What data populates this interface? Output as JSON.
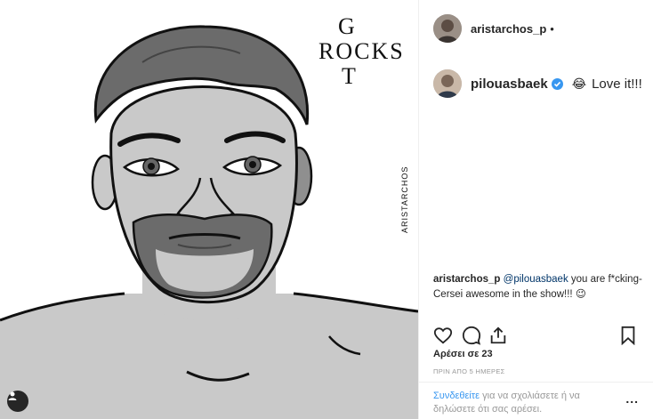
{
  "post": {
    "author": {
      "username": "aristarchos_p",
      "dot": "•"
    },
    "image": {
      "logo_text": "GOT ROCKS",
      "signature": "ARISTARCHOS"
    },
    "top_comment": {
      "username": "pilouasbaek",
      "verified": true,
      "emoji": "😂",
      "text": "Love it!!!"
    },
    "caption": {
      "username": "aristarchos_p",
      "mention": "@pilouasbaek",
      "text": "you are f*cking-Cersei awesome in the show!!!",
      "emoji": "😉"
    },
    "likes_text": "Αρέσει σε 23",
    "timestamp": "ΠΡΙΝ ΑΠΟ 5 ΗΜΕΡΕΣ",
    "login_prompt": {
      "link": "Συνδεθείτε",
      "text": "για να σχολιάσετε ή να δηλώσετε ότι σας αρέσει."
    },
    "more_label": "..."
  },
  "icons": {
    "like": "heart-icon",
    "comment": "comment-icon",
    "share": "share-icon",
    "save": "bookmark-icon",
    "user_tag": "user-icon",
    "verified": "verified-badge-icon"
  },
  "colors": {
    "link": "#3897f0",
    "text": "#262626",
    "muted": "#999999"
  }
}
